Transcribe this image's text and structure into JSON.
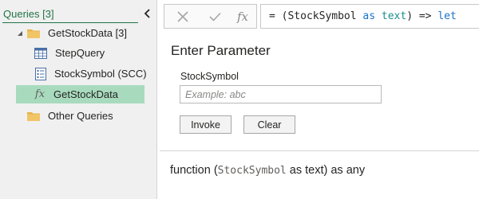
{
  "queries_pane": {
    "title": "Queries [3]",
    "items": [
      {
        "label": "GetStockData [3]",
        "icon": "folder-icon"
      },
      {
        "label": "StepQuery",
        "icon": "table-icon"
      },
      {
        "label": "StockSymbol (SCC)",
        "icon": "parameter-icon"
      },
      {
        "label": "GetStockData",
        "icon": "function-icon",
        "selected": true
      },
      {
        "label": "Other Queries",
        "icon": "folder-icon"
      }
    ]
  },
  "formula_bar": {
    "fx_label": "fx",
    "eq": "= (StockSymbol ",
    "as_kw": "as",
    "type_kw": "text",
    "close": ") => ",
    "let_kw": "let"
  },
  "invoke_panel": {
    "title": "Enter Parameter",
    "param_label": "StockSymbol",
    "param_placeholder": "Example: abc",
    "param_value": "",
    "invoke_label": "Invoke",
    "clear_label": "Clear"
  },
  "signature": {
    "prefix": "function (",
    "param": "StockSymbol",
    "suffix": " as text) as any"
  },
  "colors": {
    "accent": "#217346",
    "selected_bg": "#a8dbbe",
    "folder": "#e8b34a"
  }
}
